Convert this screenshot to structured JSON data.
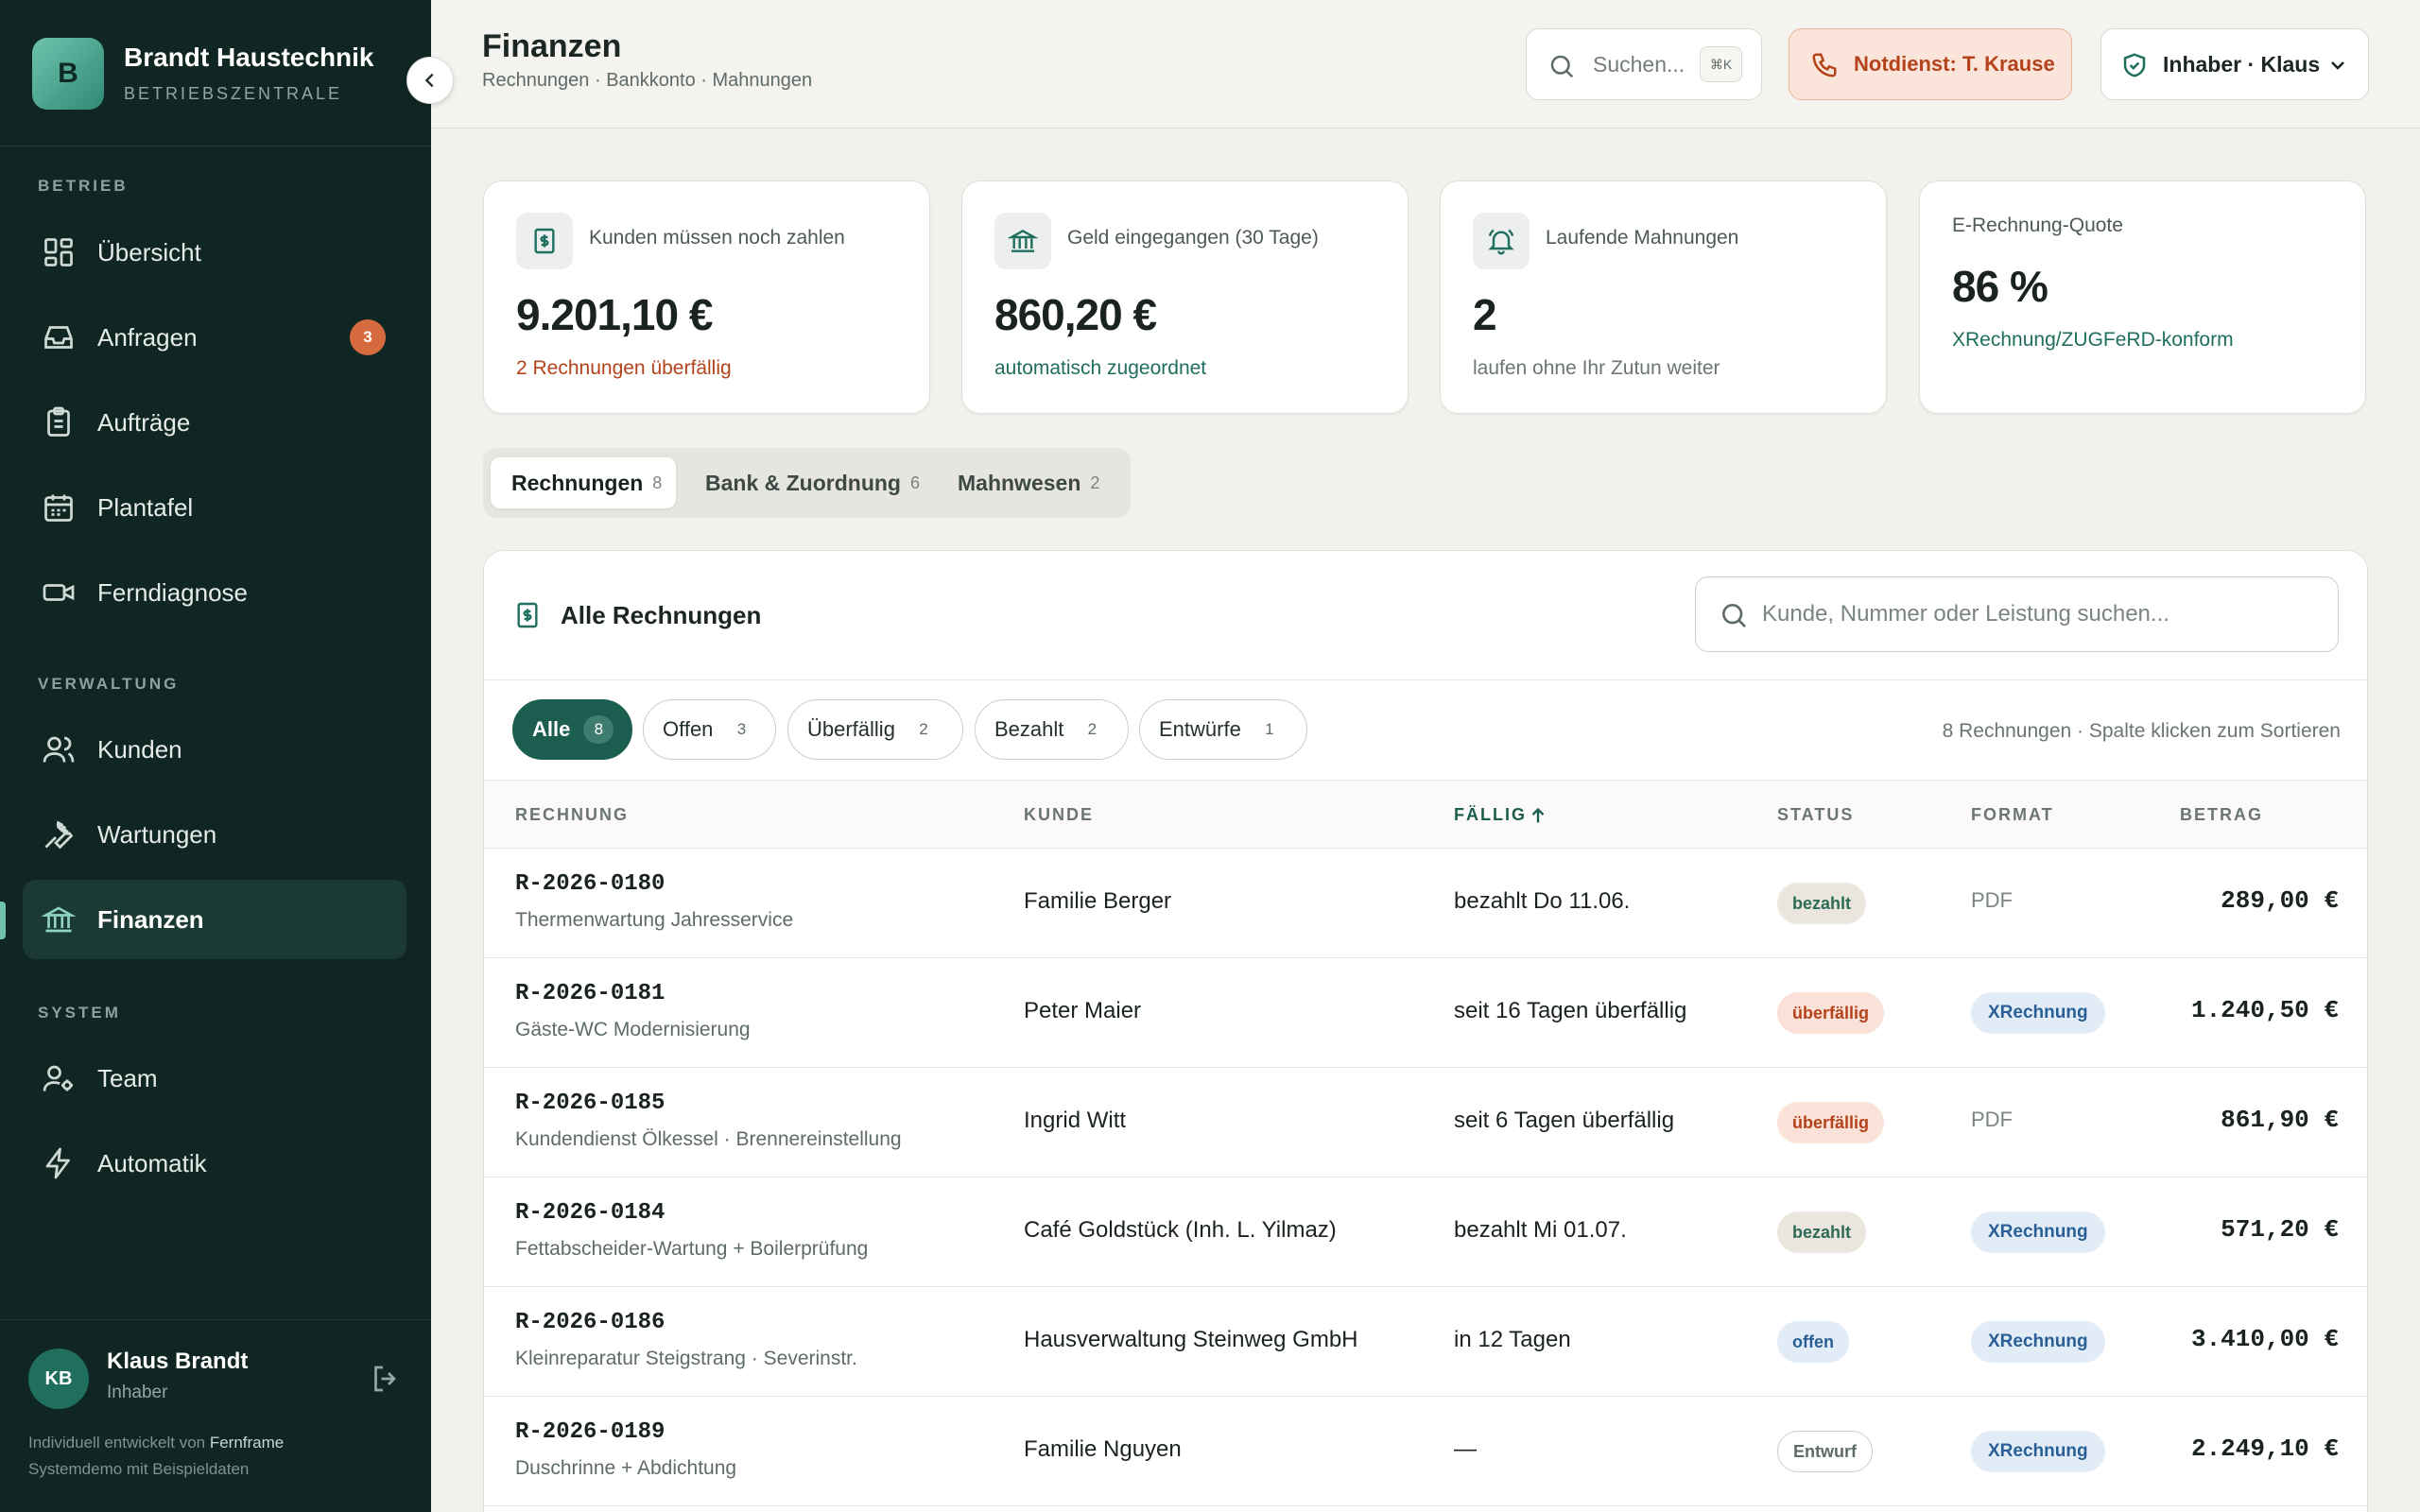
{
  "brand": {
    "logo_letter": "B",
    "name": "Brandt Haustechnik",
    "subtitle": "BETRIEBSZENTRALE"
  },
  "sidebar": {
    "sections": [
      {
        "label": "BETRIEB",
        "items": [
          {
            "label": "Übersicht",
            "icon": "grid-icon"
          },
          {
            "label": "Anfragen",
            "icon": "inbox-icon",
            "badge": "3"
          },
          {
            "label": "Aufträge",
            "icon": "clipboard-icon"
          },
          {
            "label": "Plantafel",
            "icon": "calendar-icon"
          },
          {
            "label": "Ferndiagnose",
            "icon": "video-icon"
          }
        ]
      },
      {
        "label": "VERWALTUNG",
        "items": [
          {
            "label": "Kunden",
            "icon": "users-icon"
          },
          {
            "label": "Wartungen",
            "icon": "wrench-icon"
          },
          {
            "label": "Finanzen",
            "icon": "bank-icon",
            "active": true
          }
        ]
      },
      {
        "label": "SYSTEM",
        "items": [
          {
            "label": "Team",
            "icon": "user-cog-icon"
          },
          {
            "label": "Automatik",
            "icon": "lightning-icon"
          }
        ]
      }
    ],
    "user": {
      "initials": "KB",
      "name": "Klaus Brandt",
      "role": "Inhaber"
    },
    "credit_prefix": "Individuell entwickelt von",
    "credit_name": "Fernframe",
    "credit_line2": "Systemdemo mit Beispieldaten"
  },
  "header": {
    "title": "Finanzen",
    "breadcrumb": "Rechnungen · Bankkonto · Mahnungen",
    "search_placeholder": "Suchen...",
    "search_shortcut": "⌘K",
    "emergency": "Notdienst: T. Krause",
    "role_selector": "Inhaber · Klaus"
  },
  "kpis": [
    {
      "label": "Kunden müssen noch zahlen",
      "value": "9.201,10 €",
      "sub": "2 Rechnungen überfällig",
      "sub_color": "#b4431b",
      "icon": "invoice-icon"
    },
    {
      "label": "Geld eingegangen (30 Tage)",
      "value": "860,20 €",
      "sub": "automatisch zugeordnet",
      "sub_color": "#1f6e5e",
      "icon": "bank-icon"
    },
    {
      "label": "Laufende Mahnungen",
      "value": "2",
      "sub": "laufen ohne Ihr Zutun weiter",
      "sub_color": "#6b7571",
      "icon": "bell-icon"
    },
    {
      "label": "E-Rechnung-Quote",
      "value": "86 %",
      "sub": "XRechnung/ZUGFeRD-konform",
      "sub_color": "#1f6e5e"
    }
  ],
  "tabs": [
    {
      "label": "Rechnungen",
      "count": "8",
      "active": true
    },
    {
      "label": "Bank & Zuordnung",
      "count": "6"
    },
    {
      "label": "Mahnwesen",
      "count": "2"
    }
  ],
  "invoices": {
    "title": "Alle Rechnungen",
    "search_placeholder": "Kunde, Nummer oder Leistung suchen...",
    "filters": [
      {
        "label": "Alle",
        "count": "8",
        "active": true
      },
      {
        "label": "Offen",
        "count": "3"
      },
      {
        "label": "Überfällig",
        "count": "2"
      },
      {
        "label": "Bezahlt",
        "count": "2"
      },
      {
        "label": "Entwürfe",
        "count": "1"
      }
    ],
    "hint": "8 Rechnungen · Spalte klicken zum Sortieren",
    "columns": [
      "RECHNUNG",
      "KUNDE",
      "FÄLLIG",
      "STATUS",
      "FORMAT",
      "BETRAG"
    ],
    "sorted_column": "FÄLLIG",
    "rows": [
      {
        "number": "R-2026-0180",
        "description": "Thermenwartung Jahresservice",
        "customer": "Familie Berger",
        "due": "bezahlt Do 11.06.",
        "status": "bezahlt",
        "status_type": "bezahlt",
        "format": "PDF",
        "amount": "289,00 €"
      },
      {
        "number": "R-2026-0181",
        "description": "Gäste-WC Modernisierung",
        "customer": "Peter Maier",
        "due": "seit 16 Tagen überfällig",
        "status": "überfällig",
        "status_type": "ueberfaellig",
        "format": "XRechnung",
        "amount": "1.240,50 €"
      },
      {
        "number": "R-2026-0185",
        "description": "Kundendienst Ölkessel · Brennereinstellung",
        "customer": "Ingrid Witt",
        "due": "seit 6 Tagen überfällig",
        "status": "überfällig",
        "status_type": "ueberfaellig",
        "format": "PDF",
        "amount": "861,90 €"
      },
      {
        "number": "R-2026-0184",
        "description": "Fettabscheider-Wartung + Boilerprüfung",
        "customer": "Café Goldstück (Inh. L. Yilmaz)",
        "due": "bezahlt Mi 01.07.",
        "status": "bezahlt",
        "status_type": "bezahlt",
        "format": "XRechnung",
        "amount": "571,20 €"
      },
      {
        "number": "R-2026-0186",
        "description": "Kleinreparatur Steigstrang · Severinstr.",
        "customer": "Hausverwaltung Steinweg GmbH",
        "due": "in 12 Tagen",
        "status": "offen",
        "status_type": "offen",
        "format": "XRechnung",
        "amount": "3.410,00 €"
      },
      {
        "number": "R-2026-0189",
        "description": "Duschrinne + Abdichtung",
        "customer": "Familie Nguyen",
        "due": "—",
        "status": "Entwurf",
        "status_type": "entwurf",
        "format": "XRechnung",
        "amount": "2.249,10 €"
      }
    ]
  },
  "colors": {
    "sidebar_bg": "#102622",
    "accent": "#1b5e4f",
    "danger": "#b4431b",
    "emergency_bg": "#fbe4d9"
  }
}
